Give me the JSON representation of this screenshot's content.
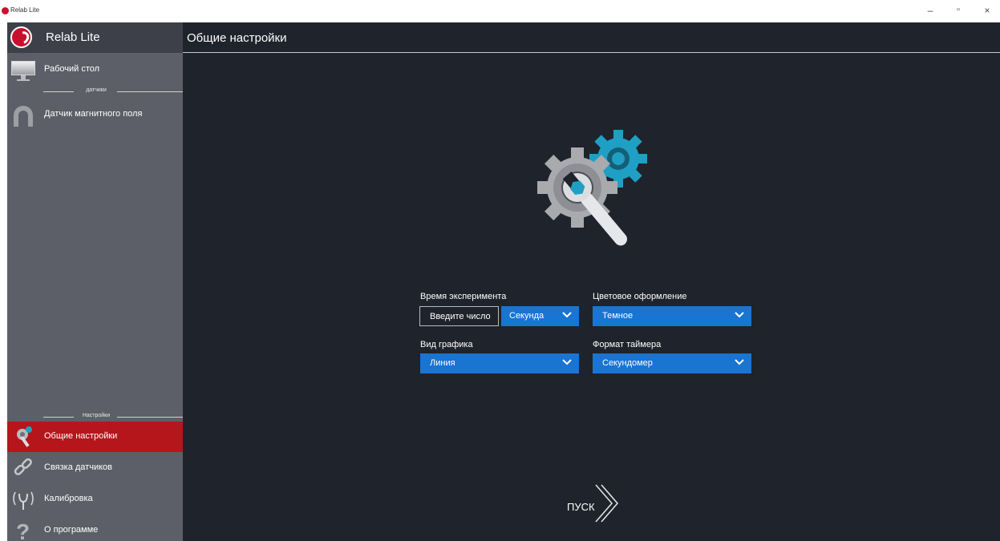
{
  "window": {
    "title": "Relab Lite",
    "controls": {
      "minimize": "–",
      "maximize": "▫",
      "close": "×"
    }
  },
  "sidebar": {
    "app_name": "Relab Lite",
    "items_top": [
      {
        "label": "Рабочий стол",
        "icon": "monitor-icon"
      }
    ],
    "sensors_section": "датчики",
    "sensors": [
      {
        "label": "Датчик магнитного поля",
        "icon": "magnet-icon"
      }
    ],
    "settings_section": "Настройки",
    "settings_items": [
      {
        "label": "Общие настройки",
        "icon": "gear-wrench-icon",
        "active": true
      },
      {
        "label": "Связка датчиков",
        "icon": "link-icon"
      },
      {
        "label": "Калибровка",
        "icon": "antenna-icon"
      },
      {
        "label": "О программе",
        "icon": "question-icon"
      }
    ]
  },
  "main": {
    "title": "Общие настройки",
    "experiment_time": {
      "label": "Время эксперимента",
      "input_placeholder": "Введите число",
      "unit_value": "Секунда"
    },
    "color_scheme": {
      "label": "Цветовое оформление",
      "value": "Темное"
    },
    "graph_type": {
      "label": "Вид графика",
      "value": "Линия"
    },
    "timer_format": {
      "label": "Формат таймера",
      "value": "Секундомер"
    },
    "start_label": "ПУСК"
  },
  "colors": {
    "accent_blue": "#1a74d1",
    "active_red": "#b5161b",
    "sidebar_bg": "#5c5f67",
    "main_bg": "#1f232c",
    "gear_teal": "#1f9fc3"
  }
}
